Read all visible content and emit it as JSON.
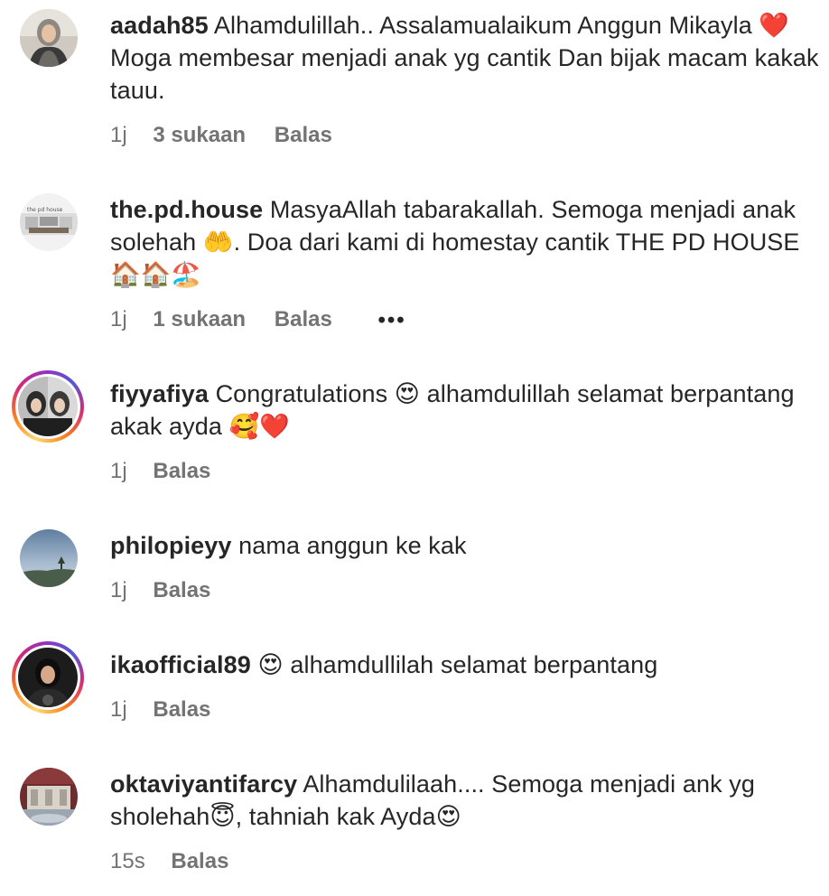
{
  "comments": [
    {
      "username": "aadah85",
      "text": "Alhamdulillah.. Assalamualaikum Anggun Mikayla ❤️ Moga membesar menjadi anak yg cantik Dan bijak macam kakak tauu.",
      "time": "1j",
      "likes": "3 sukaan",
      "reply": "Balas"
    },
    {
      "username": "the.pd.house",
      "text": "MasyaAllah tabarakallah. Semoga menjadi anak solehah 🤲. Doa dari kami di homestay cantik THE PD HOUSE 🏠🏠🏖️",
      "time": "1j",
      "likes": "1 sukaan",
      "reply": "Balas",
      "more": "•••"
    },
    {
      "username": "fiyyafiya",
      "text": "Congratulations 😍 alhamdulillah selamat berpantang akak ayda 🥰❤️",
      "time": "1j",
      "reply": "Balas"
    },
    {
      "username": "philopieyy",
      "text": "nama anggun ke kak",
      "time": "1j",
      "reply": "Balas"
    },
    {
      "username": "ikaofficial89",
      "text": "😍 alhamdullilah selamat berpantang",
      "time": "1j",
      "reply": "Balas"
    },
    {
      "username": "oktaviyantifarcy",
      "text": "Alhamdulilaah.... Semoga menjadi ank yg sholehah😇, tahniah kak Ayda😍",
      "time": "15s",
      "reply": "Balas"
    }
  ],
  "colors": {
    "text": "#262626",
    "muted": "#737373",
    "ring": "#d62976"
  }
}
